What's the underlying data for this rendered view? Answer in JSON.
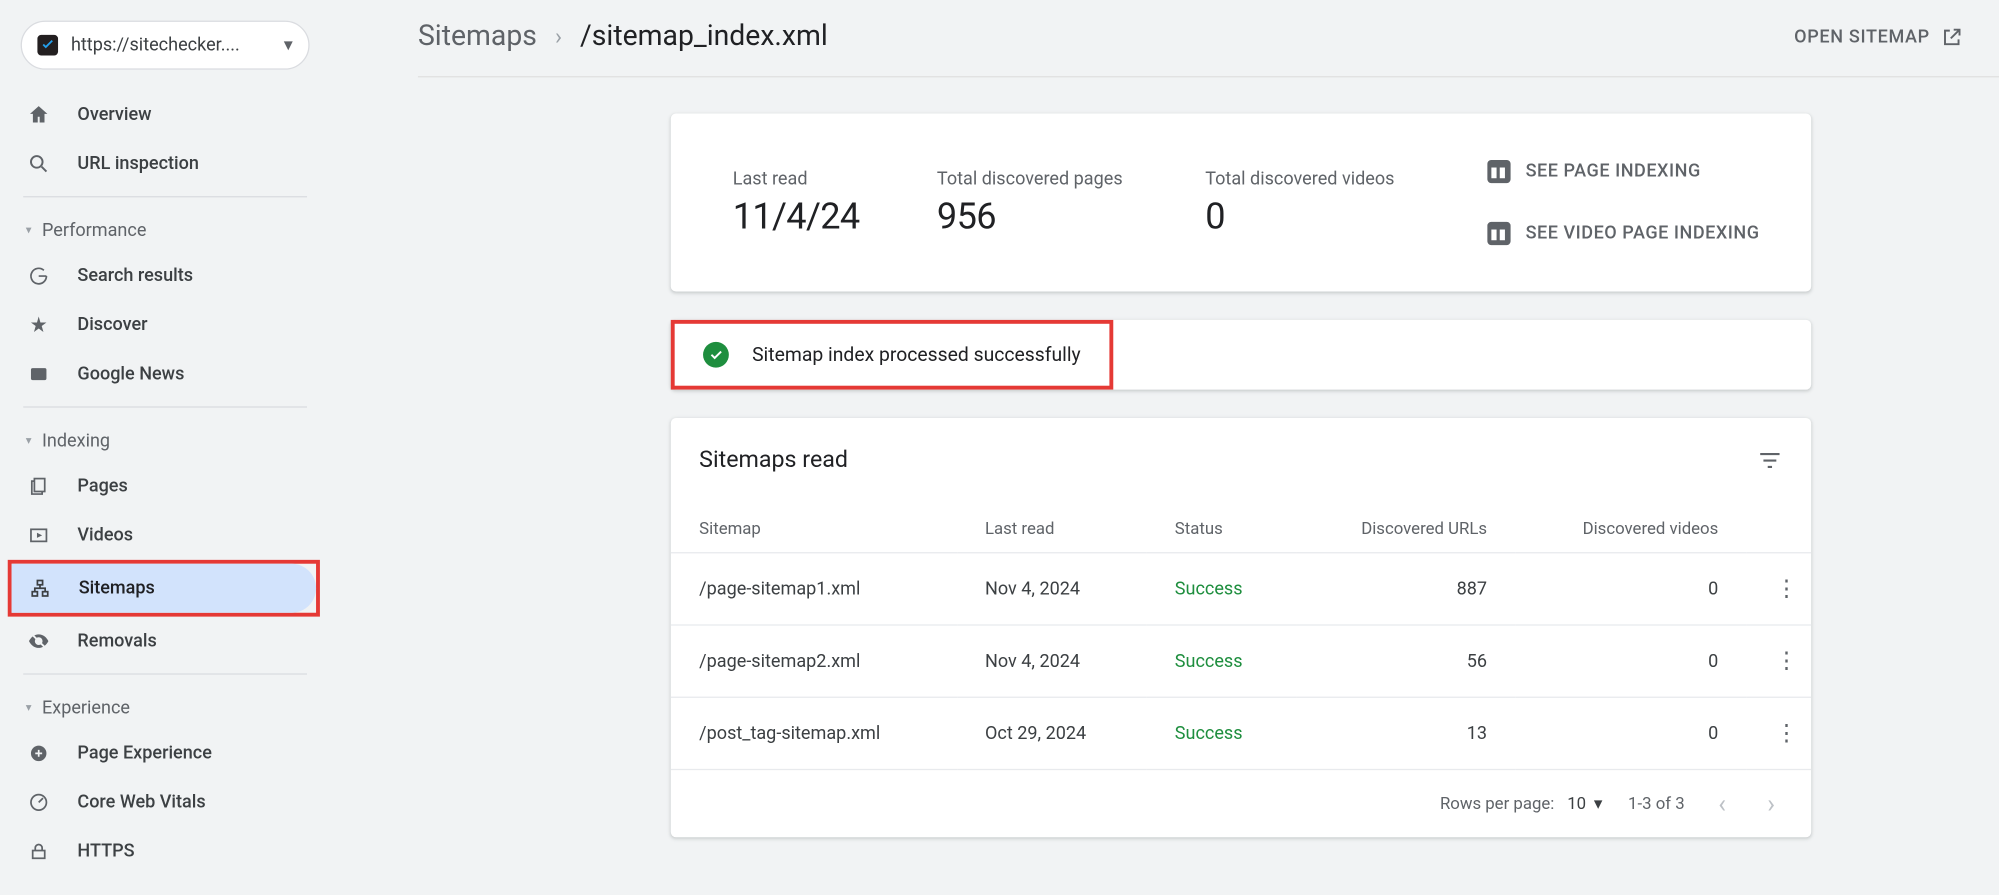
{
  "domain_picker": {
    "text": "https://sitechecker...."
  },
  "sidebar": {
    "overview": "Overview",
    "url_inspection": "URL inspection",
    "sections": {
      "performance": {
        "label": "Performance",
        "items": [
          "Search results",
          "Discover",
          "Google News"
        ]
      },
      "indexing": {
        "label": "Indexing",
        "items": [
          "Pages",
          "Videos",
          "Sitemaps",
          "Removals"
        ]
      },
      "experience": {
        "label": "Experience",
        "items": [
          "Page Experience",
          "Core Web Vitals",
          "HTTPS"
        ]
      }
    }
  },
  "breadcrumb": {
    "root": "Sitemaps",
    "current": "/sitemap_index.xml"
  },
  "open_sitemap_label": "OPEN SITEMAP",
  "stats": {
    "last_read": {
      "label": "Last read",
      "value": "11/4/24"
    },
    "pages": {
      "label": "Total discovered pages",
      "value": "956"
    },
    "videos": {
      "label": "Total discovered videos",
      "value": "0"
    }
  },
  "indexing_links": {
    "page": "SEE PAGE INDEXING",
    "video": "SEE VIDEO PAGE INDEXING"
  },
  "status_message": "Sitemap index processed successfully",
  "table": {
    "title": "Sitemaps read",
    "columns": [
      "Sitemap",
      "Last read",
      "Status",
      "Discovered URLs",
      "Discovered videos"
    ],
    "rows": [
      {
        "sitemap": "/page-sitemap1.xml",
        "last_read": "Nov 4, 2024",
        "status": "Success",
        "urls": "887",
        "videos": "0"
      },
      {
        "sitemap": "/page-sitemap2.xml",
        "last_read": "Nov 4, 2024",
        "status": "Success",
        "urls": "56",
        "videos": "0"
      },
      {
        "sitemap": "/post_tag-sitemap.xml",
        "last_read": "Oct 29, 2024",
        "status": "Success",
        "urls": "13",
        "videos": "0"
      }
    ],
    "footer": {
      "rows_per_page_label": "Rows per page:",
      "rows_per_page_value": "10",
      "range": "1-3 of 3"
    }
  }
}
